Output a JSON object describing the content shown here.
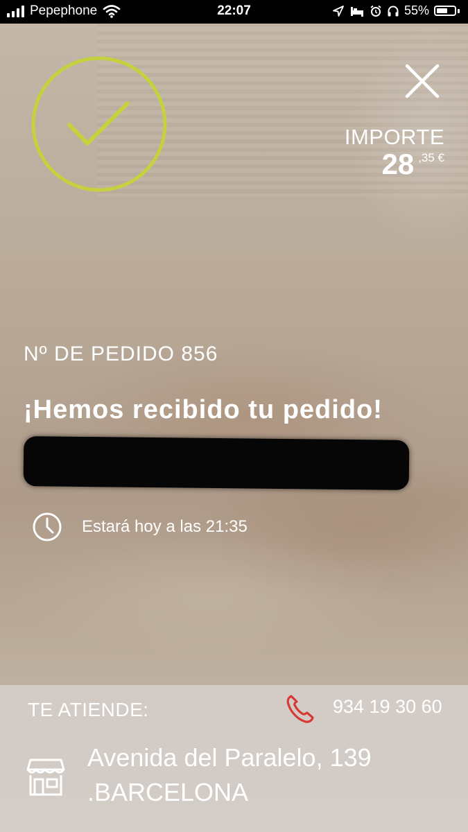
{
  "status_bar": {
    "carrier": "Pepephone",
    "time": "22:07",
    "battery": "55%",
    "icons": [
      "wifi-icon",
      "location-arrow-icon",
      "bed-icon",
      "alarm-icon",
      "headphones-icon",
      "battery-icon"
    ]
  },
  "order": {
    "importe_label": "IMPORTE",
    "importe_integer": "28",
    "importe_decimal": ",35 €",
    "number_label": "Nº DE PEDIDO 856",
    "message": "¡Hemos recibido tu pedido!",
    "eta": "Estará hoy a las 21:35"
  },
  "footer": {
    "attends_label": "TE ATIENDE:",
    "phone": "934 19 30 60",
    "address_line1": "Avenida del Paralelo, 139",
    "address_line2": ".BARCELONA"
  },
  "colors": {
    "accent_check": "#c5d23e",
    "phone_icon": "#d63a33",
    "text": "#ffffff",
    "footer_bg": "#d4cec8"
  }
}
